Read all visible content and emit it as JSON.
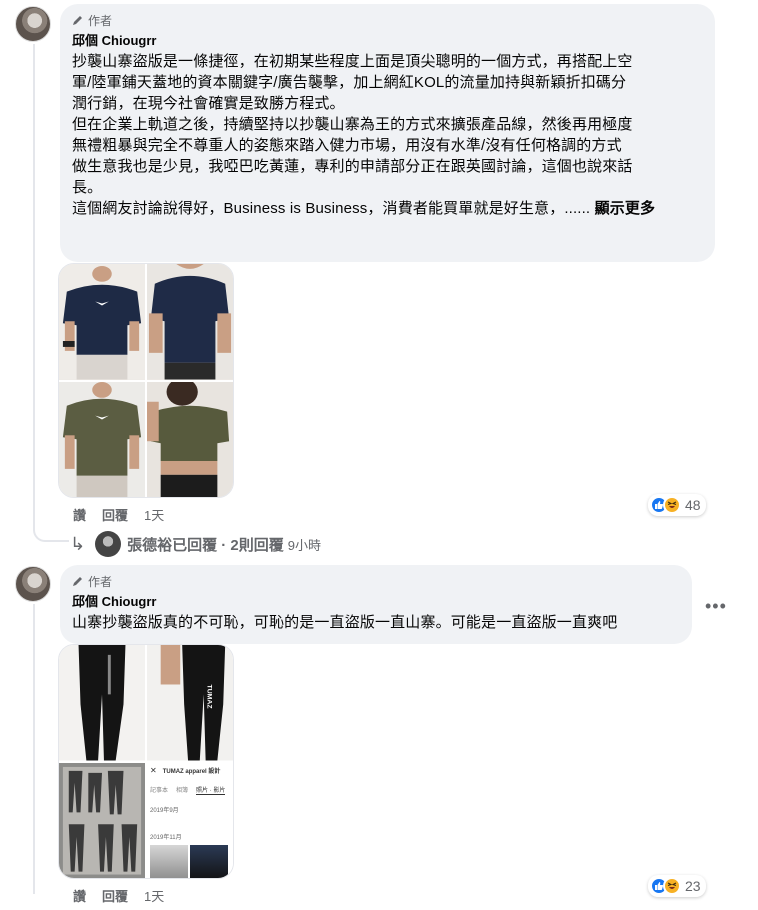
{
  "comments": [
    {
      "badge": "作者",
      "author": "邱個 Chiougrr",
      "text_lines": [
        "抄襲山寨盜版是一條捷徑，在初期某些程度上面是頂尖聰明的一個方式，再搭配上空",
        "軍/陸軍鋪天蓋地的資本關鍵字/廣告襲擊，加上網紅KOL的流量加持與新穎折扣碼分",
        "潤行銷，在現今社會確實是致勝方程式。",
        "但在企業上軌道之後，持續堅持以抄襲山寨為王的方式來擴張產品線，然後再用極度",
        "無禮粗暴與完全不尊重人的姿態來踏入健力市場，用沒有水準/沒有任何格調的方式",
        "做生意我也是少見，我啞巴吃黃蓮，專利的申請部分正在跟英國討論，這個也說來話",
        "長。",
        "這個網友討論說得好，Business is Business，消費者能買單就是好生意，......"
      ],
      "see_more": "顯示更多",
      "actions": {
        "like": "讚",
        "reply": "回覆",
        "time": "1天"
      },
      "reactions": {
        "count": "48",
        "types": [
          "like-icon",
          "haha-icon"
        ]
      },
      "photos": [
        {
          "desc": "navy-tshirt-front",
          "logo": ""
        },
        {
          "desc": "navy-tshirt-model",
          "logo": ""
        },
        {
          "desc": "olive-tshirt-front",
          "logo": ""
        },
        {
          "desc": "olive-crop-tshirt",
          "logo": ""
        }
      ]
    },
    {
      "badge": "作者",
      "author": "邱個 Chiougrr",
      "text_lines": [
        "山寨抄襲盜版真的不可恥，可恥的是一直盜版一直山寨。可能是一直盜版一直爽吧"
      ],
      "more_menu": "•••",
      "actions": {
        "like": "讚",
        "reply": "回覆",
        "time": "1天"
      },
      "reactions": {
        "count": "23",
        "types": [
          "like-icon",
          "haha-icon"
        ]
      },
      "photos": [
        {
          "desc": "black-leggings-left",
          "logo": ""
        },
        {
          "desc": "black-leggings-right",
          "logo": "TUMAZ"
        },
        {
          "desc": "leggings-sketches",
          "logo": ""
        },
        {
          "desc": "app-screenshot",
          "logo": ""
        }
      ],
      "screenshot_panel": {
        "close": "✕",
        "title": "TUMAZ apparel 設計",
        "tab1": "記事本",
        "tab2": "相簿",
        "tab3": "照片 · 影片",
        "date1": "2019年9月",
        "date2": "2019年11月"
      }
    }
  ],
  "reply_summary": {
    "arrow": "↳",
    "text": "張德裕已回覆 · 2則回覆",
    "time": "9小時"
  },
  "colors": {
    "bubble_bg": "#f0f2f5",
    "secondary_text": "#65676b",
    "like_blue": "#1877f2",
    "haha_yellow": "#f7b125"
  }
}
